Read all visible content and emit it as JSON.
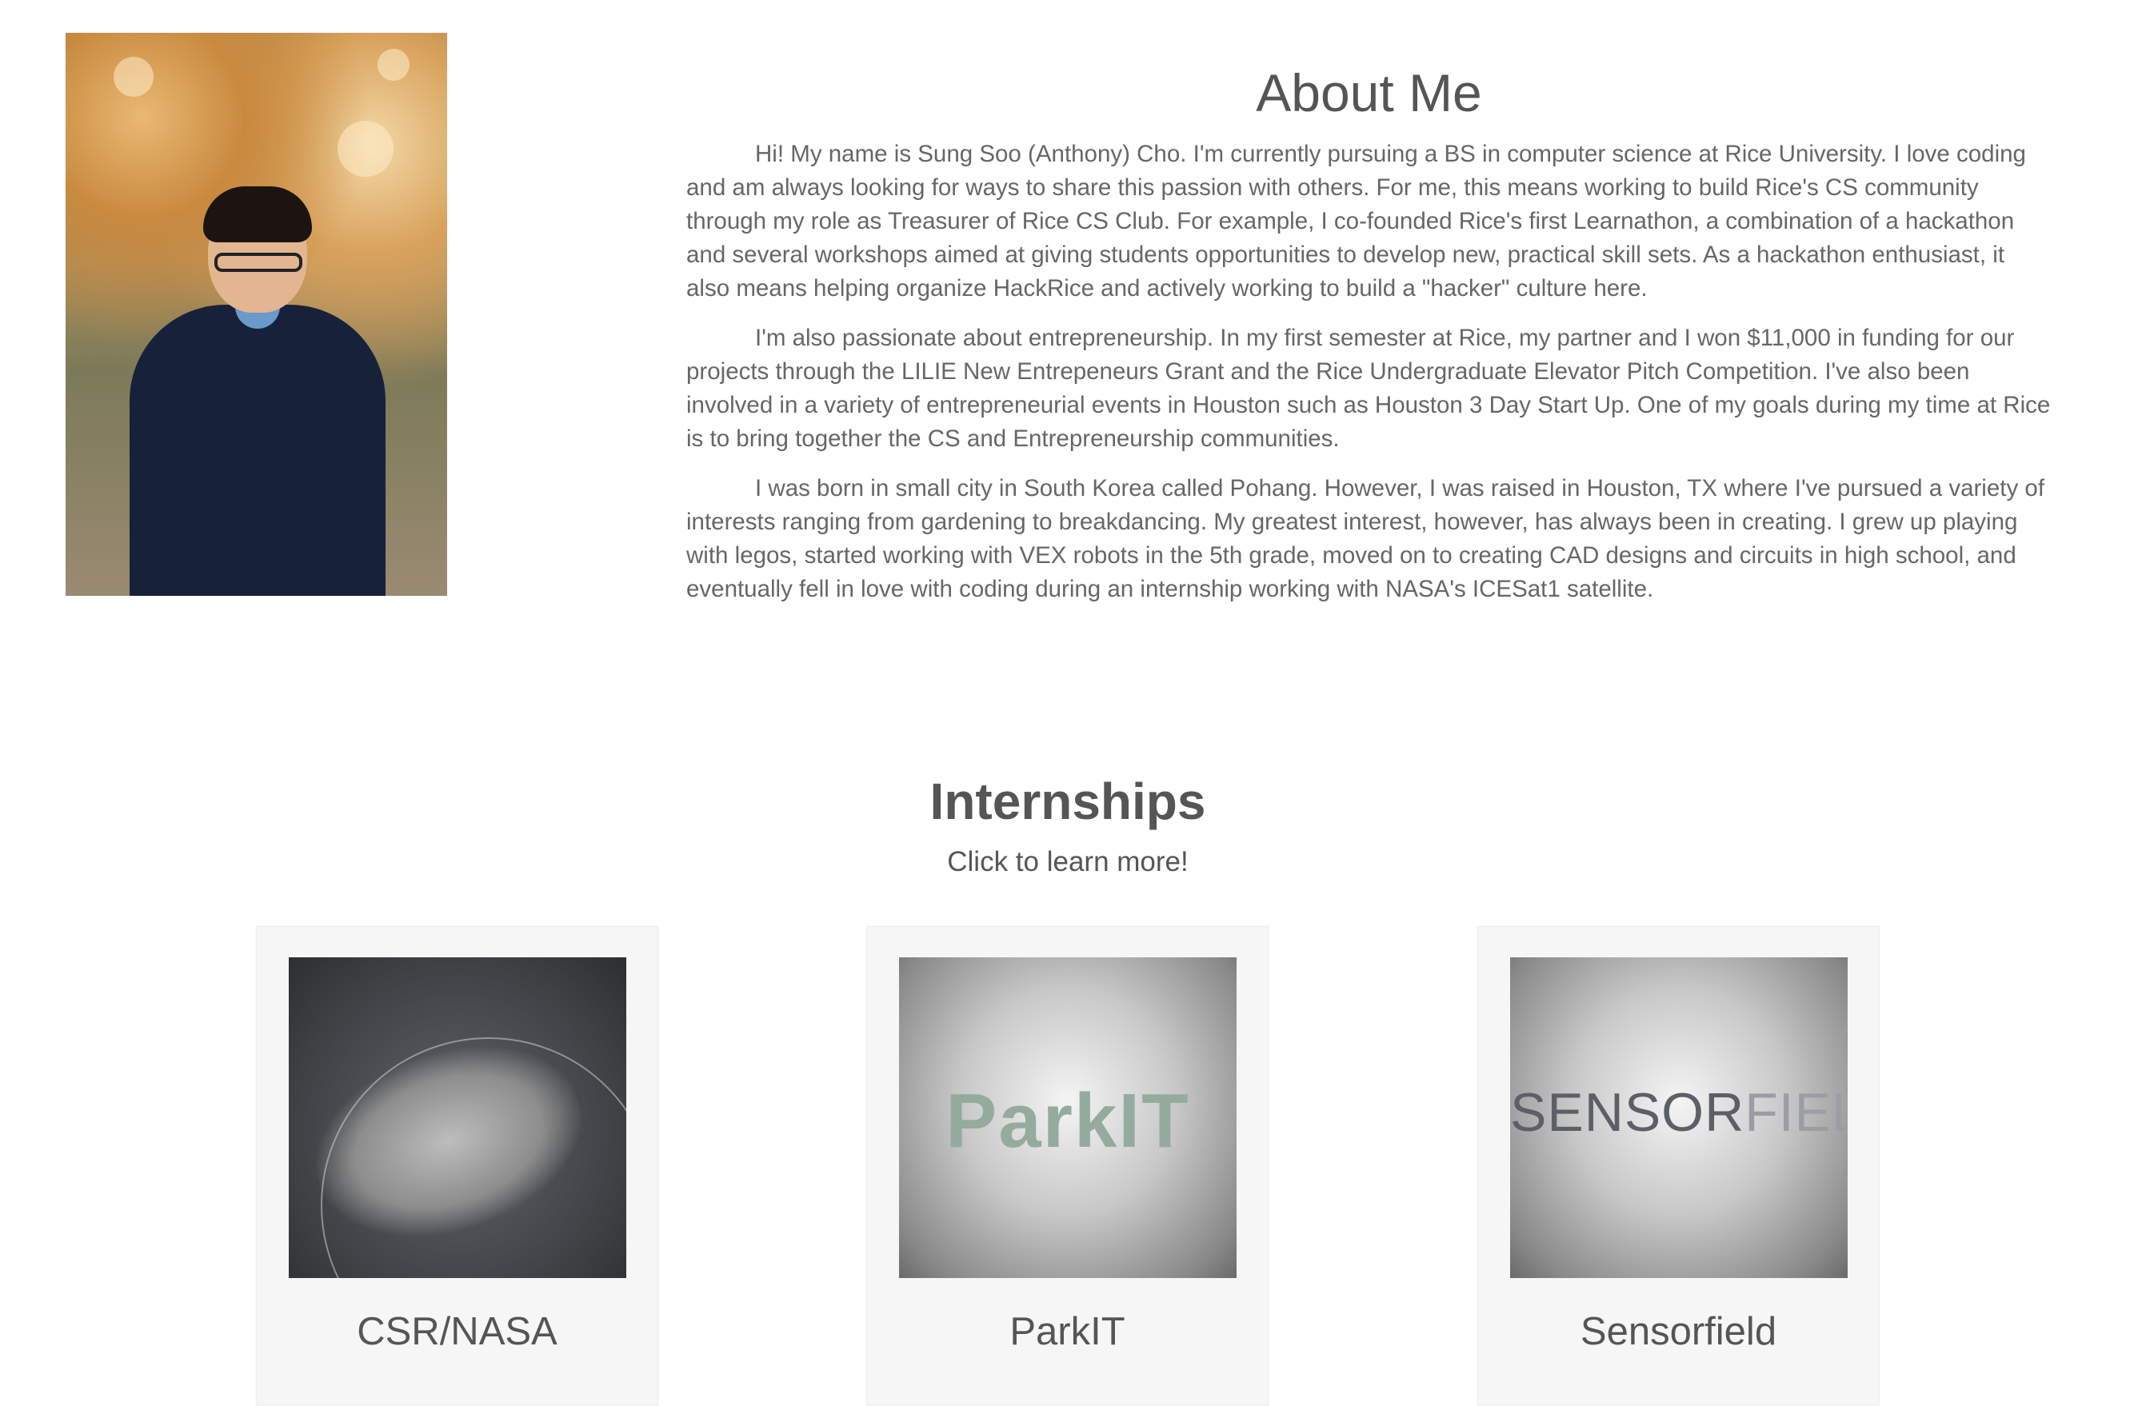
{
  "about": {
    "title": "About Me",
    "paragraphs": [
      "Hi! My name is Sung Soo (Anthony) Cho. I'm currently pursuing a BS in computer science at Rice University. I love coding and am always looking for ways to share this passion with others. For me, this means working to build Rice's CS community through my role as Treasurer of Rice CS Club. For example, I co-founded Rice's first Learnathon, a combination of a hackathon and several workshops aimed at giving students opportunities to develop new, practical skill sets. As a hackathon enthusiast, it also means helping organize HackRice and actively working to build a \"hacker\" culture here.",
      "I'm also passionate about entrepreneurship. In my first semester at Rice, my partner and I won $11,000 in funding for our projects through the LILIE New Entrepeneurs Grant and the Rice Undergraduate Elevator Pitch Competition. I've also been involved in a variety of entrepreneurial events in Houston such as Houston 3 Day Start Up. One of my goals during my time at Rice is to bring together the CS and Entrepreneurship communities.",
      "I was born in small city in South Korea called Pohang. However, I was raised in Houston, TX where I've pursued a variety of interests ranging from gardening to breakdancing. My greatest interest, however, has always been in creating. I grew up playing with legos, started working with VEX robots in the 5th grade, moved on to creating CAD designs and circuits in high school, and eventually fell in love with coding during an internship working with NASA's ICESat1 satellite."
    ]
  },
  "internships": {
    "title": "Internships",
    "subtitle": "Click to learn more!",
    "cards": [
      {
        "label": "CSR/NASA"
      },
      {
        "label": "ParkIT",
        "logo_text": "ParkIT"
      },
      {
        "label": "Sensorfield",
        "logo_text_a": "SENSOR",
        "logo_text_b": "FIELD"
      }
    ]
  }
}
